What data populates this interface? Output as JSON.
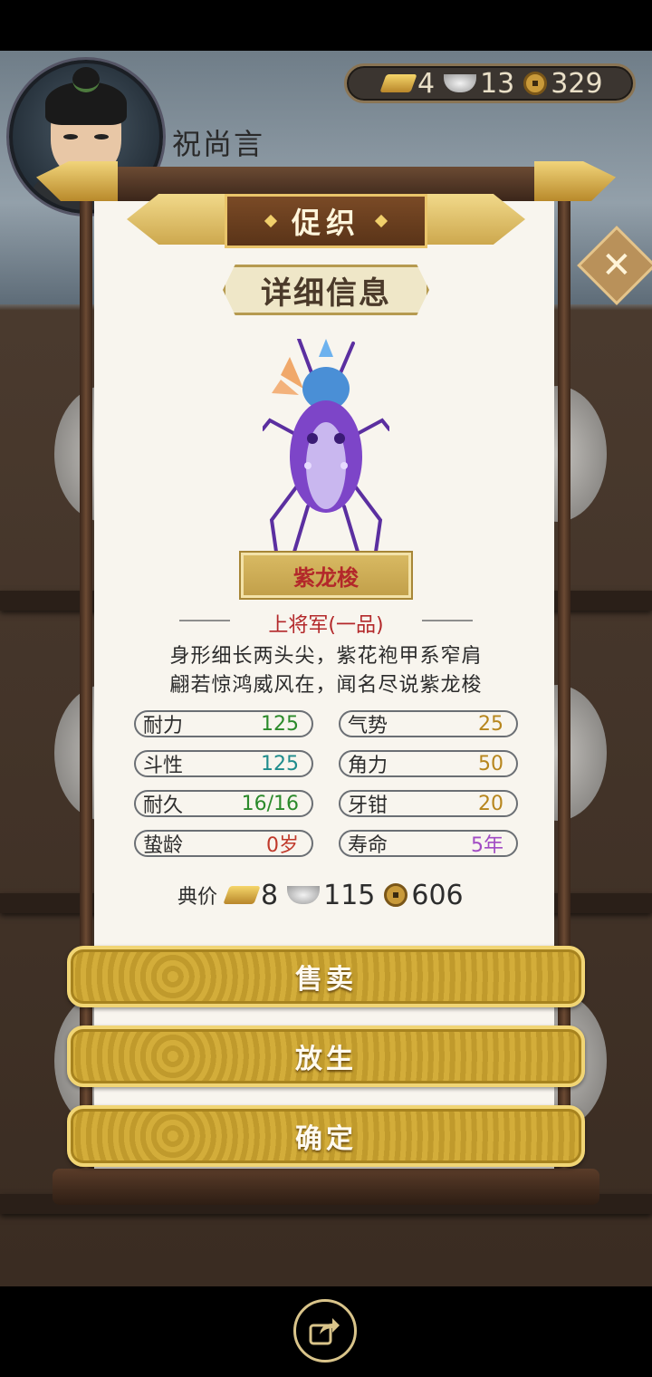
{
  "player": {
    "name": "祝尚言"
  },
  "currency": {
    "gold": "4",
    "silver": "13",
    "copper": "329"
  },
  "panel": {
    "title": "促织",
    "subtitle": "详细信息",
    "cricket_name": "紫龙梭",
    "rank": "上将军(一品)",
    "poem_line1": "身形细长两头尖，紫花袍甲系窄肩",
    "poem_line2": "翩若惊鸿威风在，闻名尽说紫龙梭"
  },
  "stats": {
    "naili": {
      "label": "耐力",
      "value": "125"
    },
    "qishi": {
      "label": "气势",
      "value": "25"
    },
    "douxing": {
      "label": "斗性",
      "value": "125"
    },
    "jiaoli": {
      "label": "角力",
      "value": "50"
    },
    "naijiu": {
      "label": "耐久",
      "value": "16/16"
    },
    "yaqian": {
      "label": "牙钳",
      "value": "20"
    },
    "zhiling": {
      "label": "蛰龄",
      "value": "0岁"
    },
    "shouming": {
      "label": "寿命",
      "value": "5年"
    }
  },
  "price": {
    "label": "典价",
    "gold": "8",
    "silver": "115",
    "copper": "606"
  },
  "buttons": {
    "sell": "售卖",
    "release": "放生",
    "confirm": "确定"
  },
  "icons": [
    "gold-ingot-icon",
    "silver-ingot-icon",
    "copper-coin-icon",
    "close-icon",
    "share-icon"
  ]
}
